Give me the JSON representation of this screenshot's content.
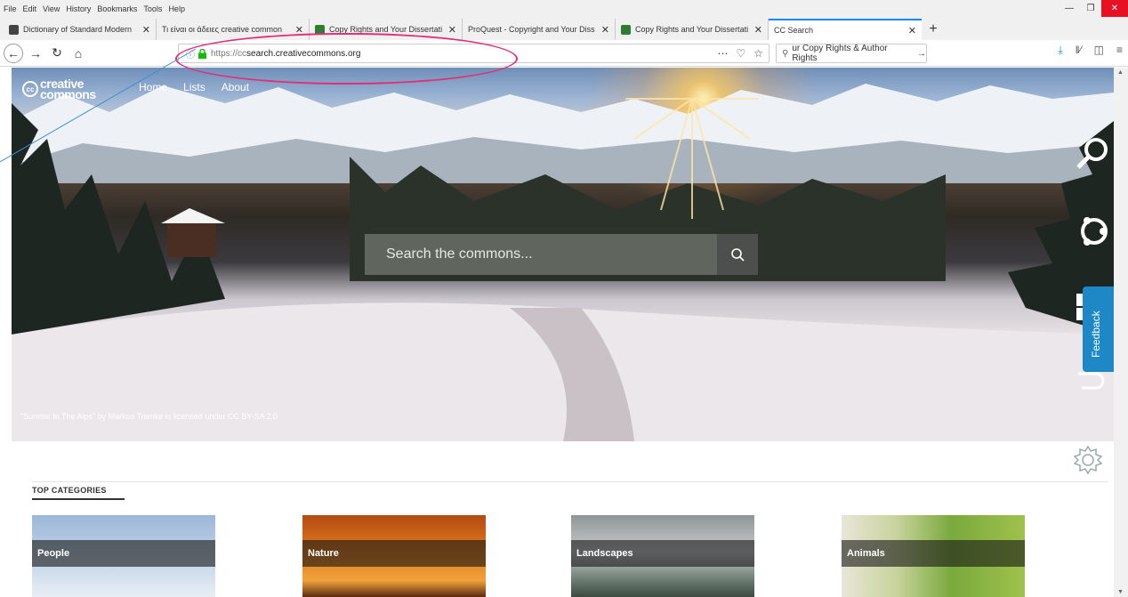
{
  "menu": [
    "File",
    "Edit",
    "View",
    "History",
    "Bookmarks",
    "Tools",
    "Help"
  ],
  "tabs": [
    {
      "label": "Dictionary of Standard Modern",
      "color": "#444"
    },
    {
      "label": "Τι είναι οι άδειες creative common",
      "color": "#888"
    },
    {
      "label": "Copy Rights and Your Dissertati",
      "color": "#2e7d32"
    },
    {
      "label": "ProQuest - Copyright and Your Diss",
      "color": "#666"
    },
    {
      "label": "Copy Rights and Your Dissertati",
      "color": "#2e7d32"
    },
    {
      "label": "CC Search",
      "color": "#fff"
    }
  ],
  "url": {
    "proto": "https://cc",
    "host": "search.creativecommons.org"
  },
  "search_bar": {
    "text": "ur Copy Rights & Author Rights"
  },
  "hero": {
    "logo_top": "creative",
    "logo_bottom": "commons",
    "nav": [
      "Home",
      "Lists",
      "About"
    ],
    "search_placeholder": "Search the commons...",
    "credit": "\"Sunrise In The Alps\" by Markus Trienke is licensed under CC BY-SA 2.0"
  },
  "feedback_label": "Feedback",
  "top_categories": {
    "title": "TOP CATEGORIES",
    "items": [
      "People",
      "Nature",
      "Landscapes",
      "Animals"
    ]
  },
  "colors": {
    "accent": "#0a84ff",
    "annotation_red": "#e0307a",
    "annotation_blue": "#3a8fd6",
    "feedback": "#1e88c7"
  }
}
